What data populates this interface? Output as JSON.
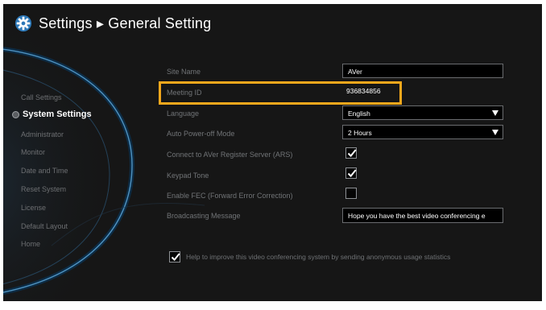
{
  "header": {
    "icon": "gear-icon",
    "title": "Settings ▸ General Setting"
  },
  "sidebar": {
    "items": [
      {
        "label": "Call Settings"
      },
      {
        "label": "System Settings",
        "active": true
      },
      {
        "label": "Administrator"
      },
      {
        "label": "Monitor"
      },
      {
        "label": "Date and Time"
      },
      {
        "label": "Reset System"
      },
      {
        "label": "License"
      },
      {
        "label": "Default Layout"
      },
      {
        "label": "Home"
      }
    ]
  },
  "form": {
    "site_name": {
      "label": "Site Name",
      "value": "AVer"
    },
    "meeting_id": {
      "label": "Meeting ID",
      "value": "936834856"
    },
    "language": {
      "label": "Language",
      "value": "English"
    },
    "auto_power_off": {
      "label": "Auto Power-off Mode",
      "value": "2 Hours"
    },
    "ars": {
      "label": "Connect to AVer Register Server (ARS)",
      "checked": true
    },
    "keypad_tone": {
      "label": "Keypad Tone",
      "checked": true
    },
    "fec": {
      "label": "Enable FEC (Forward Error Correction)",
      "checked": false
    },
    "broadcast": {
      "label": "Broadcasting Message",
      "value": "Hope you have the best video conferencing e"
    },
    "usage_stats": {
      "label": "Help to improve this video conferencing system by sending anonymous usage statistics",
      "checked": true
    }
  },
  "colors": {
    "panel_bg": "#161616",
    "highlight": "#f5a81c",
    "arc_glow": "#6fb6e6"
  }
}
